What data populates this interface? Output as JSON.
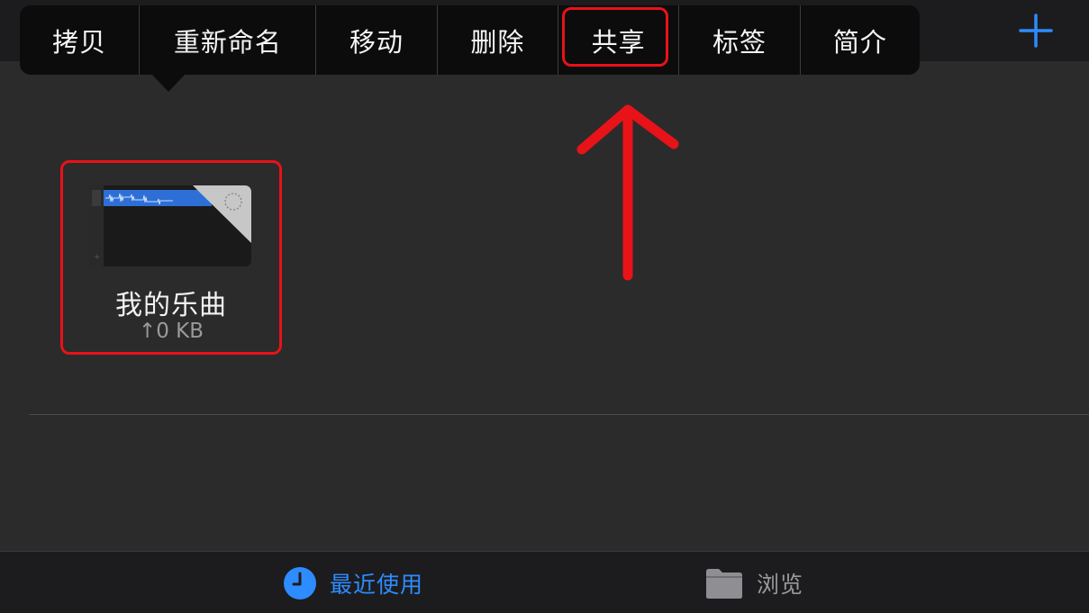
{
  "context_menu": {
    "items": [
      {
        "label": "拷贝",
        "width": 133
      },
      {
        "label": "重新命名",
        "width": 196
      },
      {
        "label": "移动",
        "width": 134
      },
      {
        "label": "删除",
        "width": 134
      },
      {
        "label": "共享",
        "width": 134
      },
      {
        "label": "标签",
        "width": 134
      },
      {
        "label": "简介",
        "width": 134
      }
    ],
    "highlighted_item": "共享"
  },
  "toolbar": {
    "add_icon": "plus-icon"
  },
  "file": {
    "name": "我的乐曲",
    "size": "↑0 KB",
    "thumbnail_icon": "garageband-project-thumbnail"
  },
  "tab_bar": {
    "tabs": [
      {
        "label": "最近使用",
        "icon": "clock-icon",
        "active": true
      },
      {
        "label": "浏览",
        "icon": "folder-icon",
        "active": false
      }
    ]
  },
  "colors": {
    "accent": "#2d8cff",
    "annotation_red": "#e81219",
    "background": "#2b2b2b",
    "bar_background": "#1c1c1e"
  }
}
